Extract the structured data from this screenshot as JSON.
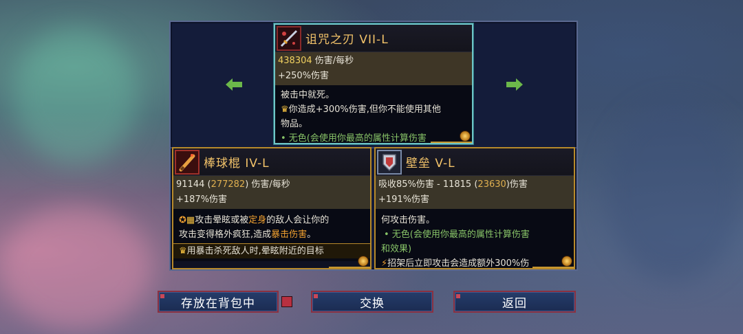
{
  "colors": {
    "title_gold": "#f4c46a",
    "border_gold": "#b88a2a",
    "selected_border": "#6fc5c8",
    "button_border": "#8a3040",
    "arrow_green": "#6cb84a"
  },
  "nav": {
    "left_arrow_icon": "arrow-left-icon",
    "right_arrow_icon": "arrow-right-icon"
  },
  "items": {
    "top": {
      "icon": "cursed-sword-icon",
      "title": "诅咒之刃 VII-L",
      "dps_value": "438304",
      "dps_suffix": " 伤害/每秒",
      "bonus": "+250%伤害",
      "desc1": "被击中就死。",
      "desc2": "你造成+300%伤害,但你不能使用其他",
      "desc3": "物品。",
      "desc4": "• 无色(会使用你最高的属性计算伤害"
    },
    "left": {
      "icon": "baseball-bat-icon",
      "title": "棒球棍 IV-L",
      "dps_value": "91144 ",
      "dps_par_open": "(",
      "dps_par": "277282",
      "dps_par_close": ")",
      "dps_suffix": " 伤害/每秒",
      "bonus": "+187%伤害",
      "d1a": "攻击晕眩或被",
      "d1b": "定身",
      "d1c": "的敌人会让你的",
      "d2a": "攻击变得格外疯狂,造成",
      "d2b": "暴击伤害",
      "d2c": "。",
      "d3": "用暴击杀死敌人时,晕眩附近的目标"
    },
    "right": {
      "icon": "rampart-shield-icon",
      "title": "壁垒 V-L",
      "s1a": "吸收85%伤害 - 11815 (",
      "s1b": "23630",
      "s1c": ")伤害",
      "bonus": "+191%伤害",
      "d1": "何攻击伤害。",
      "d2": "• 无色(会使用你最高的属性计算伤害",
      "d3": "和效果)",
      "d4": "招架后立即攻击会造成额外300%伤"
    }
  },
  "buttons": {
    "store": "存放在背包中",
    "swap": "交换",
    "back": "返回"
  }
}
